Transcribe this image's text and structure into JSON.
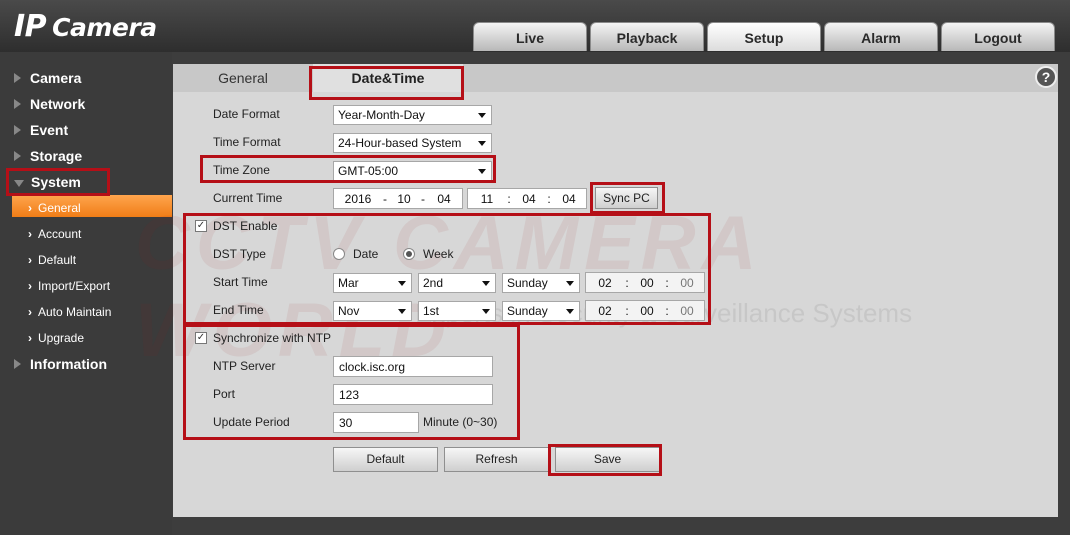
{
  "app": {
    "logo_ip": "IP",
    "logo_camera": "Camera"
  },
  "topnav": [
    "Live",
    "Playback",
    "Setup",
    "Alarm",
    "Logout"
  ],
  "sidebar": {
    "items": [
      "Camera",
      "Network",
      "Event",
      "Storage",
      "System"
    ],
    "system_sub": [
      "General",
      "Account",
      "Default",
      "Import/Export",
      "Auto Maintain",
      "Upgrade"
    ],
    "information": "Information"
  },
  "tabs": {
    "general": "General",
    "datetime": "Date&Time",
    "help": "?"
  },
  "form": {
    "date_format_label": "Date Format",
    "date_format_value": "Year-Month-Day",
    "time_format_label": "Time Format",
    "time_format_value": "24-Hour-based System",
    "time_zone_label": "Time Zone",
    "time_zone_value": "GMT-05:00",
    "current_time_label": "Current Time",
    "current_time": {
      "year": "2016",
      "month": "10",
      "day": "04",
      "hour": "11",
      "minute": "04",
      "second": "04"
    },
    "sync_pc": "Sync PC",
    "dst_enable": "DST Enable",
    "dst_type_label": "DST Type",
    "dst_type_date": "Date",
    "dst_type_week": "Week",
    "start_time_label": "Start Time",
    "start": {
      "month": "Mar",
      "week": "2nd",
      "day": "Sunday",
      "hour": "02",
      "minute": "00",
      "second": "00"
    },
    "end_time_label": "End Time",
    "end": {
      "month": "Nov",
      "week": "1st",
      "day": "Sunday",
      "hour": "02",
      "minute": "00",
      "second": "00"
    },
    "sync_ntp": "Synchronize with NTP",
    "ntp_server_label": "NTP Server",
    "ntp_server_value": "clock.isc.org",
    "port_label": "Port",
    "port_value": "123",
    "update_period_label": "Update Period",
    "update_period_value": "30",
    "update_period_unit": "Minute (0~30)"
  },
  "buttons": {
    "default": "Default",
    "refresh": "Refresh",
    "save": "Save"
  },
  "watermark": {
    "line1": "CCTV CAMERA WORLD",
    "line2": "Experts in Security & Surveillance Systems"
  },
  "colors": {
    "accent_orange": "#f07d17",
    "highlight_red": "#b50f17"
  }
}
